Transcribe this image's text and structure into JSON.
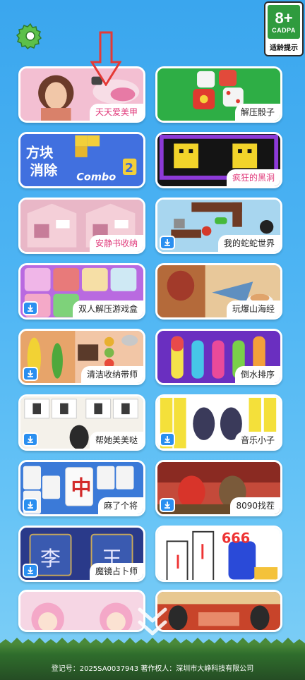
{
  "badge": {
    "age": "8+",
    "org": "CADPA",
    "label": "适龄提示"
  },
  "games": [
    {
      "title": "天天爱美甲",
      "download": false,
      "title_color": "pink"
    },
    {
      "title": "解压骰子",
      "download": false
    },
    {
      "title": "方块消除",
      "download": false,
      "art_text": [
        "方块",
        "消除",
        "Combo",
        "2"
      ]
    },
    {
      "title": "疯狂的黑洞",
      "download": false
    },
    {
      "title": "安静书收纳",
      "download": false
    },
    {
      "title": "我的蛇蛇世界",
      "download": true
    },
    {
      "title": "双人解压游戏盒",
      "download": true
    },
    {
      "title": "玩爆山海经",
      "download": true
    },
    {
      "title": "清洁收纳带师",
      "download": true
    },
    {
      "title": "倒水排序",
      "download": true
    },
    {
      "title": "帮她美美哒",
      "download": true
    },
    {
      "title": "音乐小子",
      "download": true
    },
    {
      "title": "麻了个将",
      "download": true,
      "art_text": [
        "中"
      ]
    },
    {
      "title": "8090找茬",
      "download": true
    },
    {
      "title": "魔镜占卜师",
      "download": true,
      "art_text": [
        "李",
        "王"
      ]
    },
    {
      "title": "",
      "download": false,
      "art_text": [
        "666"
      ]
    },
    {
      "title": "",
      "download": false
    },
    {
      "title": "",
      "download": false
    }
  ],
  "footer": {
    "text": "登记号：2025SA0037943  著作权人：深圳市大峥科技有限公司"
  },
  "colors": {
    "accent": "#2a8ff0",
    "badge_green": "#2f9b3e",
    "arrow_red": "#e53935"
  }
}
